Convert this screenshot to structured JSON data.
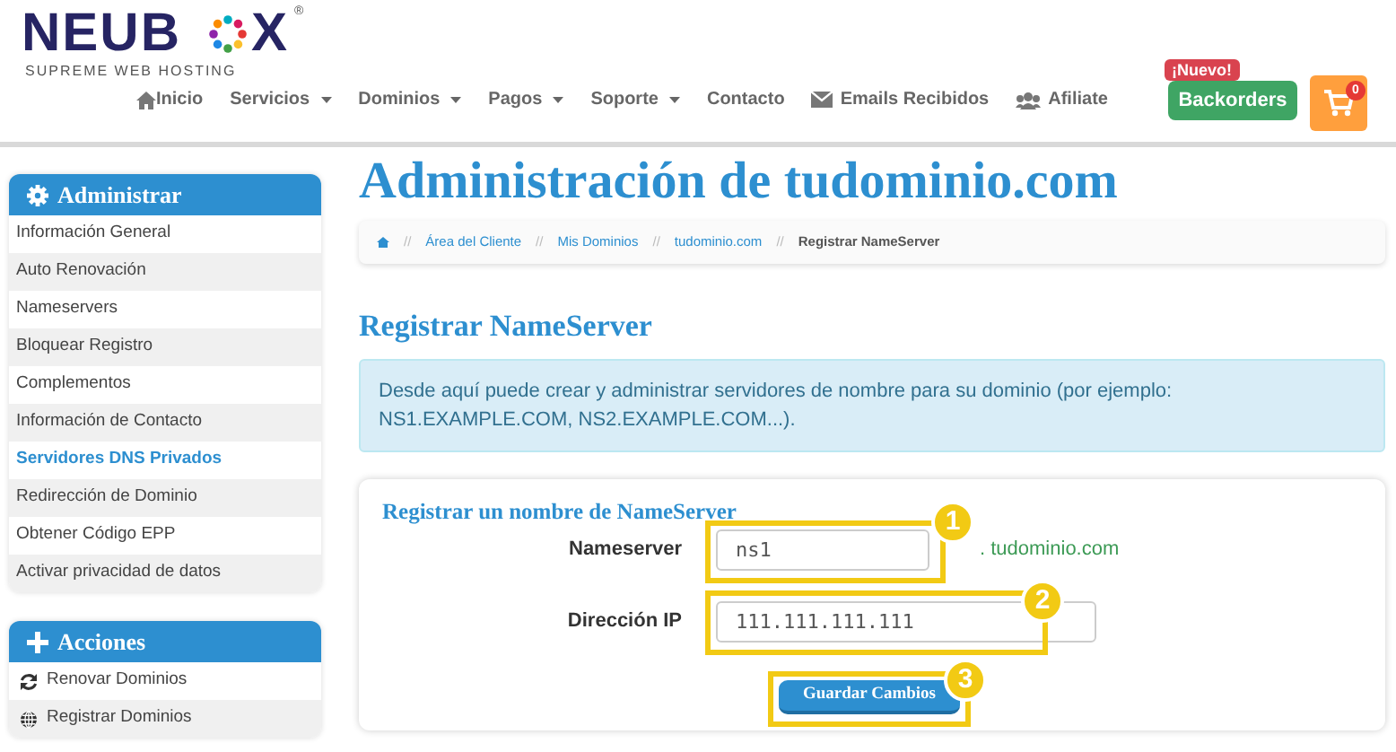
{
  "logo": {
    "text_left": "NEUB",
    "text_right": "X",
    "registered": "®",
    "tagline": "SUPREME WEB HOSTING"
  },
  "nav": [
    {
      "kind": "home",
      "label": "Inicio",
      "dropdown": false
    },
    {
      "kind": "plain",
      "label": "Servicios",
      "dropdown": true
    },
    {
      "kind": "plain",
      "label": "Dominios",
      "dropdown": true
    },
    {
      "kind": "plain",
      "label": "Pagos",
      "dropdown": true
    },
    {
      "kind": "plain",
      "label": "Soporte",
      "dropdown": true
    },
    {
      "kind": "plain",
      "label": "Contacto",
      "dropdown": false
    },
    {
      "kind": "mail",
      "label": "Emails Recibidos",
      "dropdown": false
    },
    {
      "kind": "users",
      "label": "Afiliate",
      "dropdown": false
    }
  ],
  "backorders": {
    "label": "Backorders",
    "badge": "¡Nuevo!"
  },
  "cart": {
    "count": "0"
  },
  "sidebar": [
    {
      "title": "Administrar",
      "items": [
        {
          "label": "Información General",
          "selected": false
        },
        {
          "label": "Auto Renovación",
          "selected": false
        },
        {
          "label": "Nameservers",
          "selected": false
        },
        {
          "label": "Bloquear Registro",
          "selected": false
        },
        {
          "label": "Complementos",
          "selected": false
        },
        {
          "label": "Información de Contacto",
          "selected": false
        },
        {
          "label": "Servidores DNS Privados",
          "selected": true
        },
        {
          "label": "Redirección de Dominio",
          "selected": false
        },
        {
          "label": "Obtener Código EPP",
          "selected": false
        },
        {
          "label": "Activar privacidad de datos",
          "selected": false
        }
      ]
    },
    {
      "title": "Acciones",
      "items": [
        {
          "label": "Renovar Dominios",
          "selected": false
        },
        {
          "label": "Registrar Dominios",
          "selected": false
        }
      ]
    }
  ],
  "page_title": "Administración de tudominio.com",
  "breadcrumb": [
    {
      "label": "Área del Cliente",
      "current": false
    },
    {
      "label": "Mis Dominios",
      "current": false
    },
    {
      "label": "tudominio.com",
      "current": false
    },
    {
      "label": "Registrar NameServer",
      "current": true
    }
  ],
  "breadcrumb_separator": "//",
  "section_title": "Registrar NameServer",
  "info": "Desde aquí puede crear y administrar servidores de nombre para su dominio (por ejemplo: NS1.EXAMPLE.COM, NS2.EXAMPLE.COM...).",
  "form": {
    "title": "Registrar un nombre de NameServer",
    "fields": [
      {
        "label": "Nameserver",
        "value": "ns1",
        "suffix": ". tudominio.com"
      },
      {
        "label": "Dirección IP",
        "value": "111.111.111.111"
      }
    ],
    "submit": "Guardar Cambios"
  },
  "annotations": [
    "1",
    "2",
    "3"
  ]
}
